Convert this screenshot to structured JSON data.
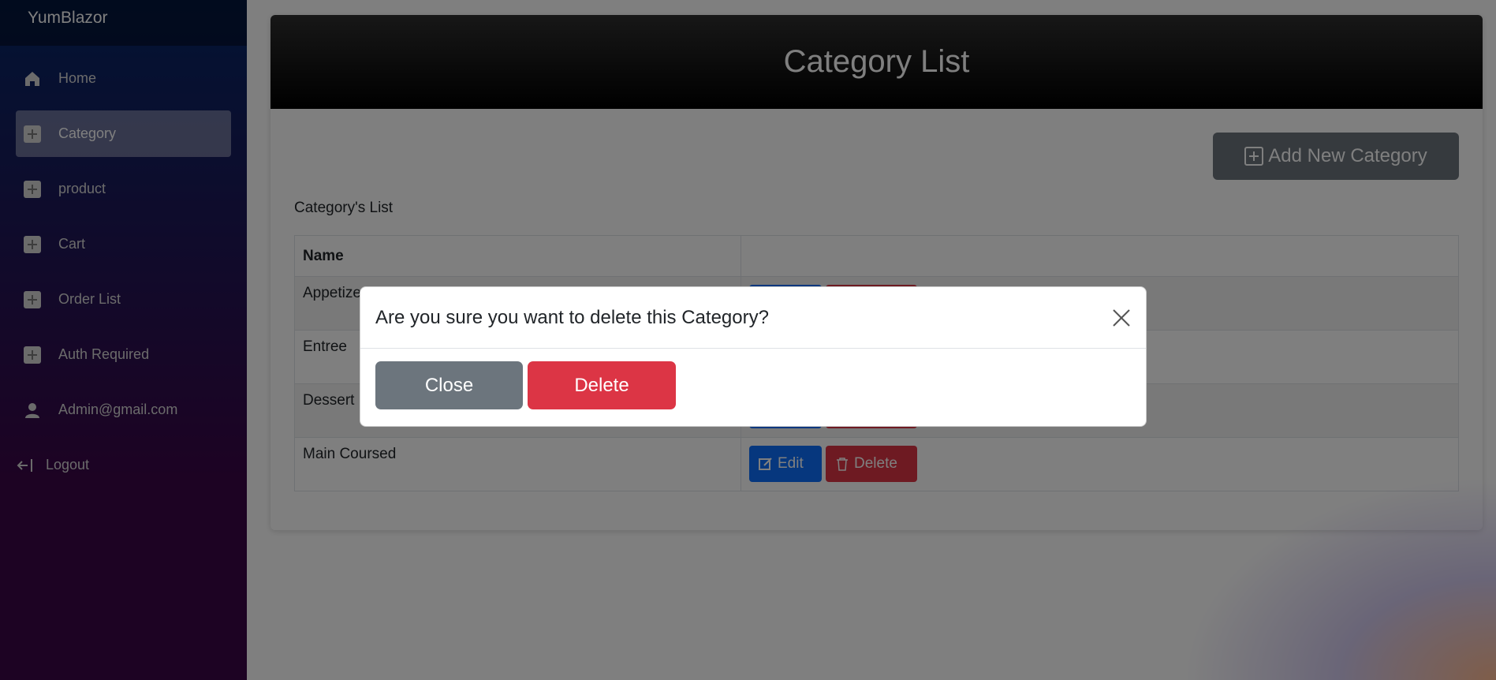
{
  "sidebar": {
    "brand": "YumBlazor",
    "items": [
      {
        "label": "Home",
        "icon": "home-icon"
      },
      {
        "label": "Category",
        "icon": "plus-square-icon",
        "active": true
      },
      {
        "label": "product",
        "icon": "plus-square-icon"
      },
      {
        "label": "Cart",
        "icon": "plus-square-icon"
      },
      {
        "label": "Order List",
        "icon": "plus-square-icon"
      },
      {
        "label": "Auth Required",
        "icon": "plus-square-icon"
      },
      {
        "label": "Admin@gmail.com",
        "icon": "person-icon"
      },
      {
        "label": "Logout",
        "icon": "logout-icon"
      }
    ]
  },
  "page": {
    "title": "Category List",
    "add_button": "Add New Category",
    "list_label": "Category's List"
  },
  "table": {
    "header": "Name",
    "rows": [
      {
        "name": "Appetizer"
      },
      {
        "name": "Entree"
      },
      {
        "name": "Dessert"
      },
      {
        "name": "Main Coursed"
      }
    ],
    "edit_label": "Edit",
    "delete_label": "Delete"
  },
  "modal": {
    "title": "Are you sure you want to delete this Category?",
    "close_label": "Close",
    "delete_label": "Delete"
  },
  "colors": {
    "primary": "#0d6efd",
    "danger": "#dc3545",
    "secondary": "#6c757d"
  }
}
